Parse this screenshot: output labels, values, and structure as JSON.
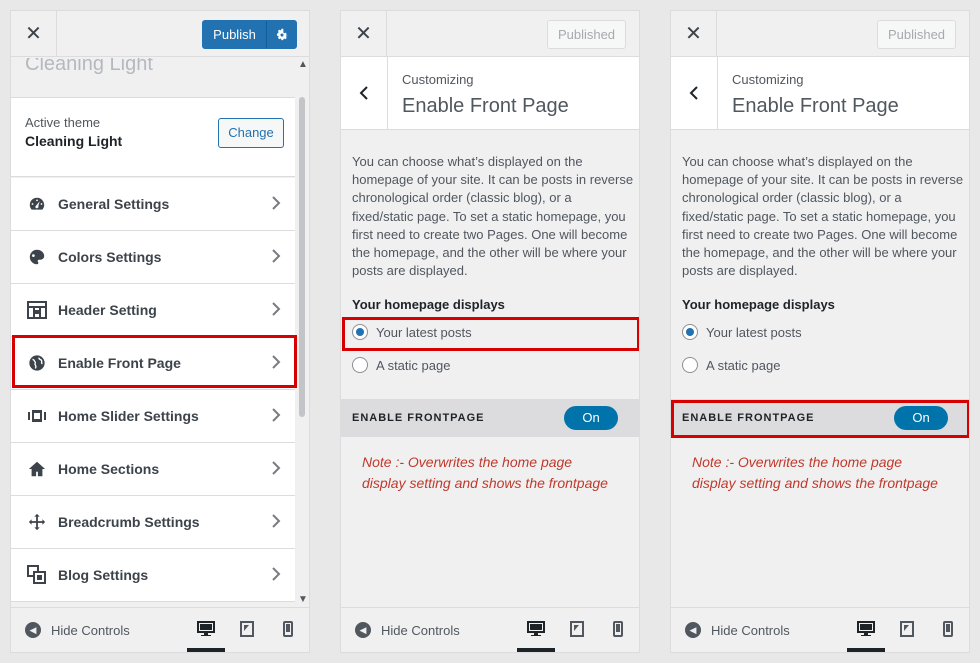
{
  "panel1": {
    "close_symbol": "✕",
    "publish_label": "Publish",
    "site_name": "Cleaning Light",
    "active_theme_label": "Active theme",
    "active_theme_name": "Cleaning Light",
    "change_label": "Change",
    "menu": [
      {
        "label": "General Settings",
        "icon": "dashboard-icon"
      },
      {
        "label": "Colors Settings",
        "icon": "palette-icon"
      },
      {
        "label": "Header Setting",
        "icon": "grid-icon"
      },
      {
        "label": "Enable Front Page",
        "icon": "globe-icon"
      },
      {
        "label": "Home Slider Settings",
        "icon": "slides-icon"
      },
      {
        "label": "Home Sections",
        "icon": "home-icon"
      },
      {
        "label": "Breadcrumb Settings",
        "icon": "move-icon"
      },
      {
        "label": "Blog Settings",
        "icon": "blog-icon"
      }
    ],
    "hide_controls": "Hide Controls"
  },
  "panel2": {
    "close_symbol": "✕",
    "published_label": "Published",
    "customizing": "Customizing",
    "title": "Enable Front Page",
    "description": "You can choose what’s displayed on the homepage of your site. It can be posts in reverse chronological order (classic blog), or a fixed/static page. To set a static homepage, you first need to create two Pages. One will become the homepage, and the other will be where your posts are displayed.",
    "homepage_displays": "Your homepage displays",
    "option_latest": "Your latest posts",
    "option_static": "A static page",
    "enable_frontpage": "ENABLE FRONTPAGE",
    "toggle_label": "On",
    "note": "Note :- Overwrites the home page display setting and shows the frontpage",
    "hide_controls": "Hide Controls"
  },
  "panel3": {
    "close_symbol": "✕",
    "published_label": "Published",
    "customizing": "Customizing",
    "title": "Enable Front Page",
    "description": "You can choose what’s displayed on the homepage of your site. It can be posts in reverse chronological order (classic blog), or a fixed/static page. To set a static homepage, you first need to create two Pages. One will become the homepage, and the other will be where your posts are displayed.",
    "homepage_displays": "Your homepage displays",
    "option_latest": "Your latest posts",
    "option_static": "A static page",
    "enable_frontpage": "ENABLE FRONTPAGE",
    "toggle_label": "On",
    "note": "Note :- Overwrites the home page display setting and shows the frontpage",
    "hide_controls": "Hide Controls"
  },
  "colors": {
    "accent": "#2271b1",
    "highlight": "#d60000",
    "note": "#c0392b",
    "toggle": "#0073aa"
  }
}
